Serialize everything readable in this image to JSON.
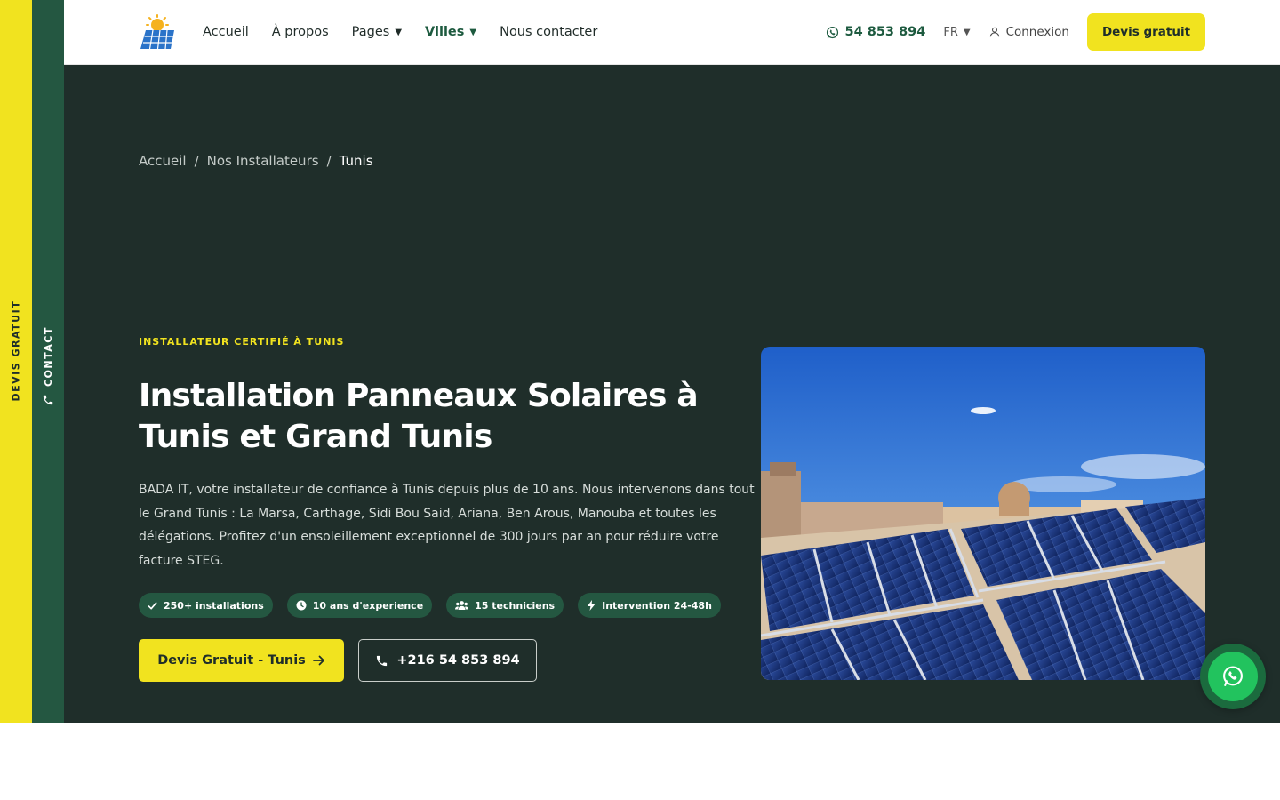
{
  "side_tabs": {
    "quote": "DEVIS GRATUIT",
    "contact": "CONTACT"
  },
  "header": {
    "nav": [
      {
        "label": "Accueil"
      },
      {
        "label": "À propos"
      },
      {
        "label": "Pages"
      },
      {
        "label": "Villes"
      },
      {
        "label": "Nous contacter"
      }
    ],
    "phone": "54 853 894",
    "language": "FR",
    "login": "Connexion",
    "quote_button": "Devis gratuit"
  },
  "breadcrumb": {
    "home": "Accueil",
    "section": "Nos Installateurs",
    "current": "Tunis"
  },
  "hero": {
    "eyebrow": "INSTALLATEUR CERTIFIÉ À TUNIS",
    "title": "Installation Panneaux Solaires à Tunis et Grand Tunis",
    "description": "BADA IT, votre installateur de confiance à Tunis depuis plus de 10 ans. Nous intervenons dans tout le Grand Tunis : La Marsa, Carthage, Sidi Bou Said, Ariana, Ben Arous, Manouba et toutes les délégations. Profitez d'un ensoleillement exceptionnel de 300 jours par an pour réduire votre facture STEG.",
    "badges": [
      {
        "icon": "check-icon",
        "label": "250+ installations"
      },
      {
        "icon": "clock-icon",
        "label": "10 ans d'experience"
      },
      {
        "icon": "users-icon",
        "label": "15 techniciens"
      },
      {
        "icon": "bolt-icon",
        "label": "Intervention 24-48h"
      }
    ],
    "cta_primary": "Devis Gratuit - Tunis",
    "cta_secondary": "+216 54 853 894"
  },
  "colors": {
    "accent_yellow": "#f1e31f",
    "brand_green": "#245741",
    "hero_bg": "#1f2e2a",
    "whatsapp_green": "#22c35e"
  }
}
